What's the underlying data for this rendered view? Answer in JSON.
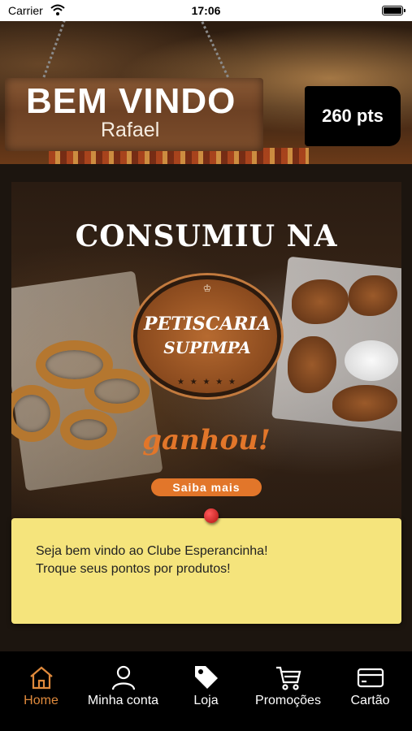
{
  "status_bar": {
    "carrier": "Carrier",
    "time": "17:06",
    "icons": [
      "wifi-icon",
      "battery-icon"
    ]
  },
  "header": {
    "welcome_title": "BEM VINDO",
    "user_name": "Rafael",
    "points": "260 pts"
  },
  "banner": {
    "heading": "CONSUMIU NA",
    "logo_line1": "PETISCARIA",
    "logo_line2": "SUPIMPA",
    "logo_crown": "♔",
    "logo_stars": "★ ★ ★ ★ ★",
    "ganhou": "ganhou!",
    "cta": "Saiba mais",
    "accent_color": "#e2762a"
  },
  "note": {
    "line1": "Seja bem vindo ao Clube Esperancinha!",
    "line2": "Troque seus pontos por produtos!",
    "background": "#f5e47c"
  },
  "tabbar": {
    "active_color": "#e08a3c",
    "tabs": [
      {
        "label": "Home",
        "icon": "home-icon",
        "active": true
      },
      {
        "label": "Minha conta",
        "icon": "user-icon",
        "active": false
      },
      {
        "label": "Loja",
        "icon": "tag-icon",
        "active": false
      },
      {
        "label": "Promoções",
        "icon": "cart-icon",
        "active": false
      },
      {
        "label": "Cartão",
        "icon": "card-icon",
        "active": false
      }
    ]
  }
}
